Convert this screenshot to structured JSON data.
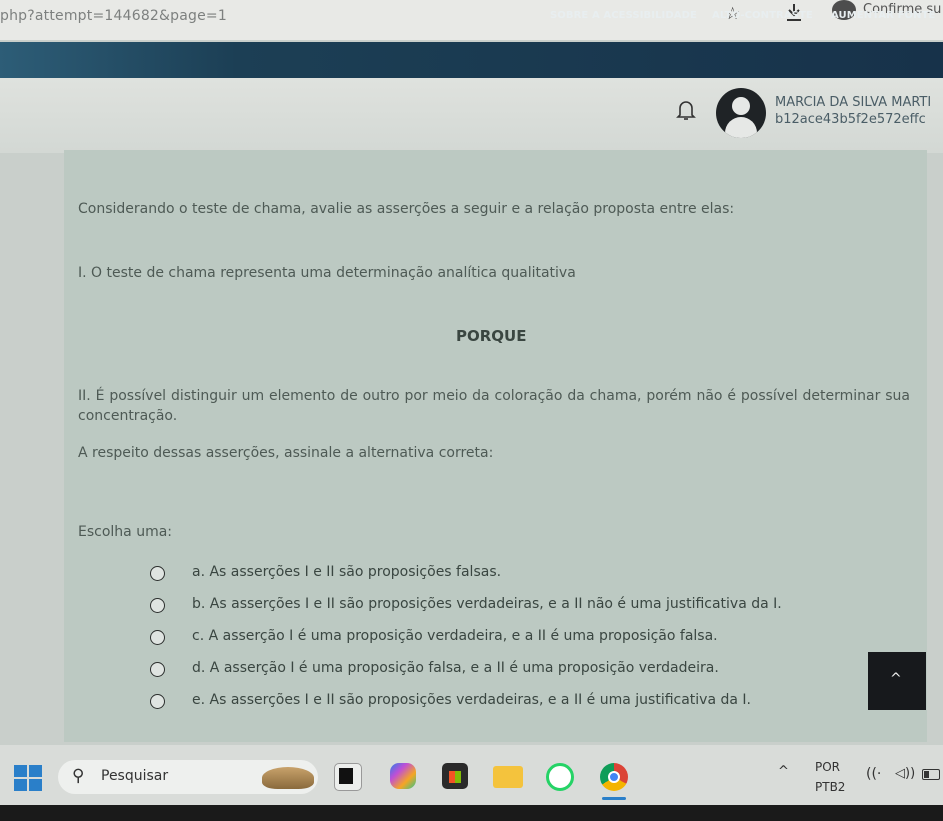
{
  "browser": {
    "url": "php?attempt=144682&page=1",
    "tab_title": "Confirme su"
  },
  "accessibility": {
    "links": [
      "SOBRE A ACESSIBILIDADE",
      "ALTO-CONTRASTE",
      "AUMENTAR FONTE"
    ]
  },
  "user": {
    "name": "MARCIA DA SILVA MARTI",
    "id": "b12ace43b5f2e572effc"
  },
  "question": {
    "intro": "Considerando o teste de chama, avalie as asserções a seguir e a relação proposta entre elas:",
    "assertion1": "I. O teste de chama representa uma determinação analítica qualitativa",
    "connector": "PORQUE",
    "assertion2": "II. É possível distinguir um elemento de outro por meio da coloração da chama, porém não é possível determinar sua concentração.",
    "prompt": "A respeito dessas asserções, assinale a alternativa correta:",
    "choose_label": "Escolha uma:",
    "options": [
      "a. As asserções I e II são proposições falsas.",
      "b. As asserções I e II são proposições verdadeiras, e a II não é uma justificativa da I.",
      "c. A asserção I é uma proposição verdadeira, e a II é uma proposição falsa.",
      "d. A asserção I é uma proposição falsa, e a II é uma proposição verdadeira.",
      "e. As asserções I e II são proposições verdadeiras, e a II é uma justificativa da I."
    ]
  },
  "taskbar": {
    "search_label": "Pesquisar",
    "lang_line1": "POR",
    "lang_line2": "PTB2",
    "icons": [
      "windows-icon",
      "search-icon",
      "widget-icon",
      "terminal-icon",
      "copilot-icon",
      "store-icon",
      "file-explorer-icon",
      "whatsapp-icon",
      "chrome-icon"
    ]
  },
  "colors": {
    "accessibility_bar": "#1c3f55",
    "card_background": "#bcc9c2",
    "scroll_button": "#17191c"
  }
}
